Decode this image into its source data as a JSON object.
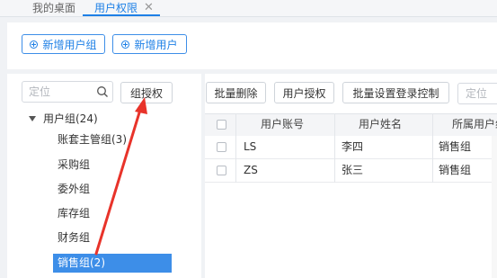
{
  "tabs": [
    {
      "label": "我的桌面"
    },
    {
      "label": "用户权限"
    }
  ],
  "tab_close": "✕",
  "toolbar": {
    "add_group_label": "新增用户组",
    "add_user_label": "新增用户"
  },
  "left": {
    "search_placeholder": "定位",
    "group_auth_label": "组授权",
    "tree_root": "用户组(24)",
    "tree_items": [
      {
        "label": "账套主管组(3)"
      },
      {
        "label": "采购组"
      },
      {
        "label": "委外组"
      },
      {
        "label": "库存组"
      },
      {
        "label": "财务组"
      },
      {
        "label": "销售组(2)"
      }
    ]
  },
  "right": {
    "batch_delete_label": "批量删除",
    "user_auth_label": "用户授权",
    "batch_login_label": "批量设置登录控制",
    "filter_placeholder": "定位",
    "columns": [
      "用户账号",
      "用户姓名",
      "所属用户组"
    ],
    "rows": [
      {
        "account": "LS",
        "name": "李四",
        "group": "销售组"
      },
      {
        "account": "ZS",
        "name": "张三",
        "group": "销售组"
      }
    ]
  },
  "colors": {
    "accent": "#1e80e6",
    "selected_bg": "#3d8ee8",
    "annotation_arrow": "#e8332a"
  }
}
